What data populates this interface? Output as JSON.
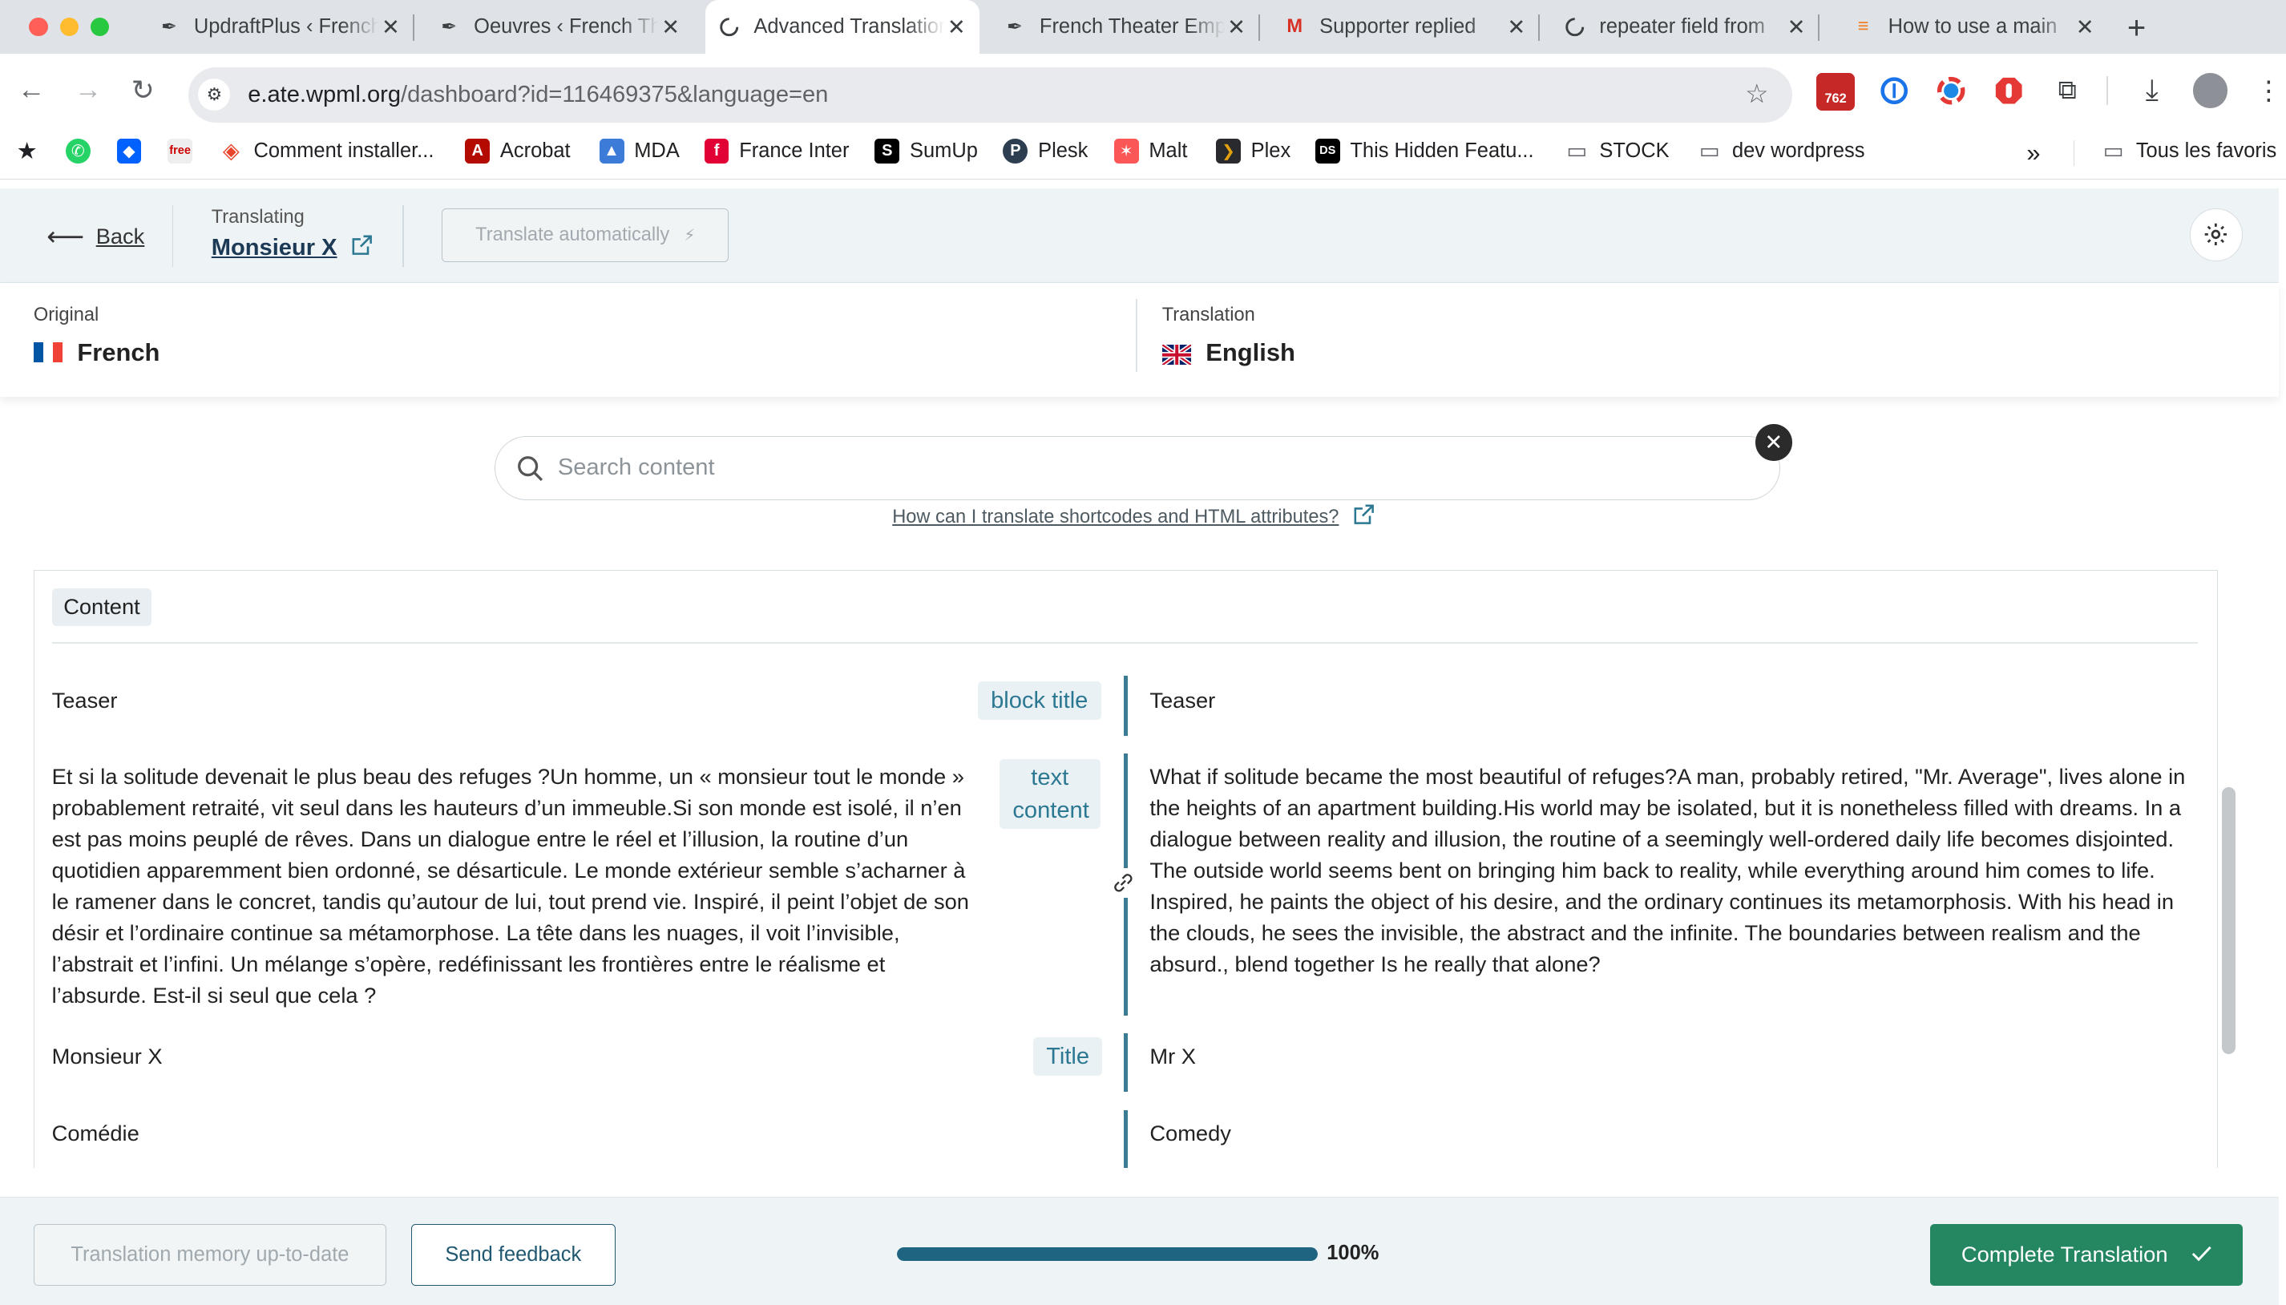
{
  "browser": {
    "tabs": [
      {
        "title": "UpdraftPlus ‹ French Theater",
        "icon": "feather-icon"
      },
      {
        "title": "Oeuvres ‹ French Theater",
        "icon": "feather-icon"
      },
      {
        "title": "Advanced Translation Editor",
        "icon": "wpml-icon"
      },
      {
        "title": "French Theater Emporium",
        "icon": "feather-icon"
      },
      {
        "title": "Supporter replied",
        "icon": "gmail-icon"
      },
      {
        "title": "repeater field from",
        "icon": "wpml-icon"
      },
      {
        "title": "How to use a main",
        "icon": "stackoverflow-icon"
      }
    ],
    "address": {
      "host": "e.ate.wpml.org",
      "path": "/dashboard?id=116469375&language=en"
    },
    "extension_badge": "762",
    "bookmarks": [
      {
        "label": "",
        "icon": "star-icon"
      },
      {
        "label": "",
        "icon": "whatsapp-icon"
      },
      {
        "label": "",
        "icon": "dropbox-icon"
      },
      {
        "label": "",
        "icon": "free-icon"
      },
      {
        "label": "Comment installer...",
        "icon": "diamond-icon"
      },
      {
        "label": "Acrobat",
        "icon": "acrobat-icon"
      },
      {
        "label": "MDA",
        "icon": "mda-icon"
      },
      {
        "label": "France Inter",
        "icon": "france-inter-icon"
      },
      {
        "label": "SumUp",
        "icon": "sumup-icon"
      },
      {
        "label": "Plesk",
        "icon": "plesk-icon"
      },
      {
        "label": "Malt",
        "icon": "malt-icon"
      },
      {
        "label": "Plex",
        "icon": "plex-icon"
      },
      {
        "label": "This Hidden Featu...",
        "icon": "ds-icon"
      },
      {
        "label": "STOCK",
        "icon": "folder-icon"
      },
      {
        "label": "dev wordpress",
        "icon": "folder-icon"
      }
    ],
    "more_bookmarks": "»",
    "all_bookmarks": "Tous les favoris"
  },
  "header": {
    "back_label": "Back",
    "translating_caption": "Translating",
    "document_name": "Monsieur X",
    "auto_translate_label": "Translate automatically"
  },
  "languages": {
    "original_caption": "Original",
    "original": "French",
    "translation_caption": "Translation",
    "translation": "English"
  },
  "search": {
    "placeholder": "Search content",
    "help_link": "How can I translate shortcodes and HTML attributes?"
  },
  "content": {
    "section_label": "Content",
    "rows": [
      {
        "source": "Teaser",
        "tag": "block title",
        "target": "Teaser"
      },
      {
        "source": "Et si la solitude devenait le plus beau des refuges ?Un homme, un « monsieur tout le monde » probablement retraité, vit seul dans les hauteurs d’un immeuble.Si son monde est isolé, il n’en est pas moins peuplé de rêves. Dans un dialogue entre le réel et l’illusion, la routine d’un quotidien apparemment bien ordonné, se désarticule. Le monde extérieur semble s’acharner à le ramener dans le concret, tandis qu’autour de lui, tout prend vie. Inspiré, il peint l’objet de son désir et l’ordinaire continue sa métamorphose. La tête dans les nuages, il voit l’invisible, l’abstrait et l’infini. Un mélange s’opère, redéfinissant les frontières entre le réalisme et l’absurde. Est-il si seul que cela ?",
        "tag": "text content",
        "target": "What if solitude became the most beautiful of refuges?A man, probably retired, \"Mr. Average\", lives alone in the heights of an apartment building.His world may be isolated, but it is nonetheless filled with dreams. In a dialogue between reality and illusion, the routine of a seemingly well-ordered daily life becomes disjointed. The outside world seems bent on bringing him back to reality, while everything around him comes to life. Inspired, he paints the object of his desire, and the ordinary continues its metamorphosis. With his head in the clouds, he sees the invisible, the abstract and the infinite. The boundaries between realism and the absurd., blend together Is he really that alone?"
      },
      {
        "source": "Monsieur X",
        "tag": "Title",
        "target": "Mr X"
      },
      {
        "source": "Comédie",
        "tag": "",
        "target": "Comedy"
      }
    ]
  },
  "footer": {
    "memory_label": "Translation memory up-to-date",
    "feedback_label": "Send feedback",
    "progress_value": 1.0,
    "progress_text": "100%",
    "complete_label": "Complete Translation"
  },
  "colors": {
    "accent": "#1f6480",
    "complete": "#258762",
    "divider": "#3b7b93"
  }
}
